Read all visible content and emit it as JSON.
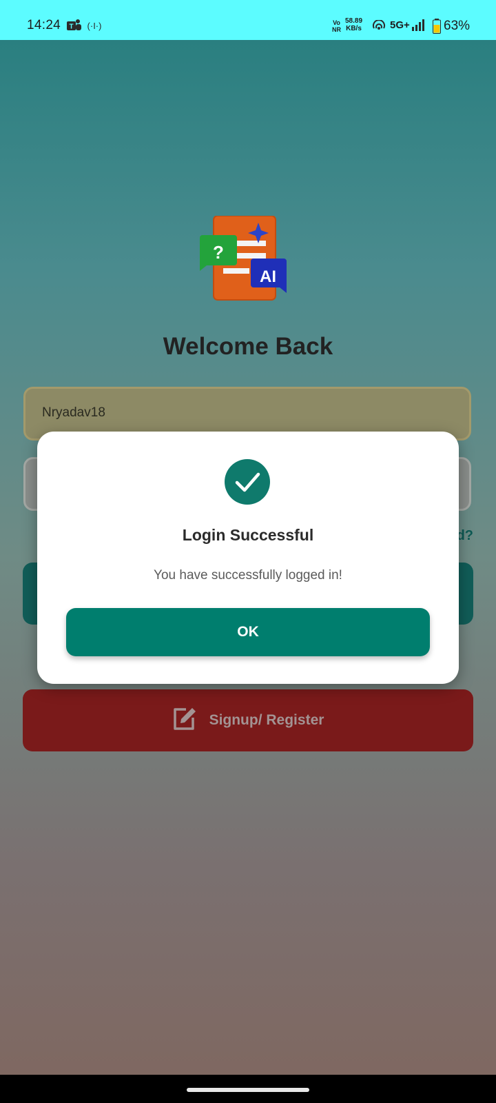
{
  "status_bar": {
    "time": "14:24",
    "volte": "Vo\nNR",
    "netspeed_value": "58.89",
    "netspeed_unit": "KB/s",
    "network": "5G+",
    "battery": "63%",
    "icons": [
      "teams-icon",
      "cast-icon",
      "hotspot-icon",
      "signal-icon",
      "battery-icon"
    ]
  },
  "screen": {
    "title": "Welcome Back",
    "username_value": "Nryadav18",
    "forgot_partial": "d?",
    "signup_label": "Signup/ Register"
  },
  "dialog": {
    "title": "Login Successful",
    "message": "You have successfully logged in!",
    "ok_label": "OK"
  },
  "colors": {
    "status_bar": "#5cfcff",
    "accent": "#007e6e",
    "signup": "#7a1a1a",
    "dialog_bg": "#ffffff"
  }
}
